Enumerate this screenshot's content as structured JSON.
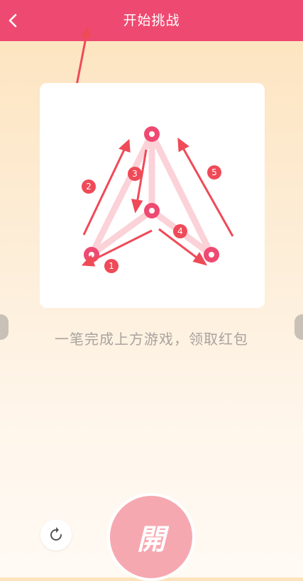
{
  "header": {
    "title": "开始挑战",
    "back_icon": "chevron-left-icon",
    "background": "#ee4a71"
  },
  "puzzle": {
    "steps": [
      "1",
      "2",
      "3",
      "4",
      "5"
    ],
    "node_color": "#ee4a71",
    "line_color": "#fbd2d8",
    "arrow_color": "#ef4a58"
  },
  "instruction": "一笔完成上方游戏，领取红包",
  "controls": {
    "reset_icon": "refresh-icon",
    "open_label": "開"
  }
}
